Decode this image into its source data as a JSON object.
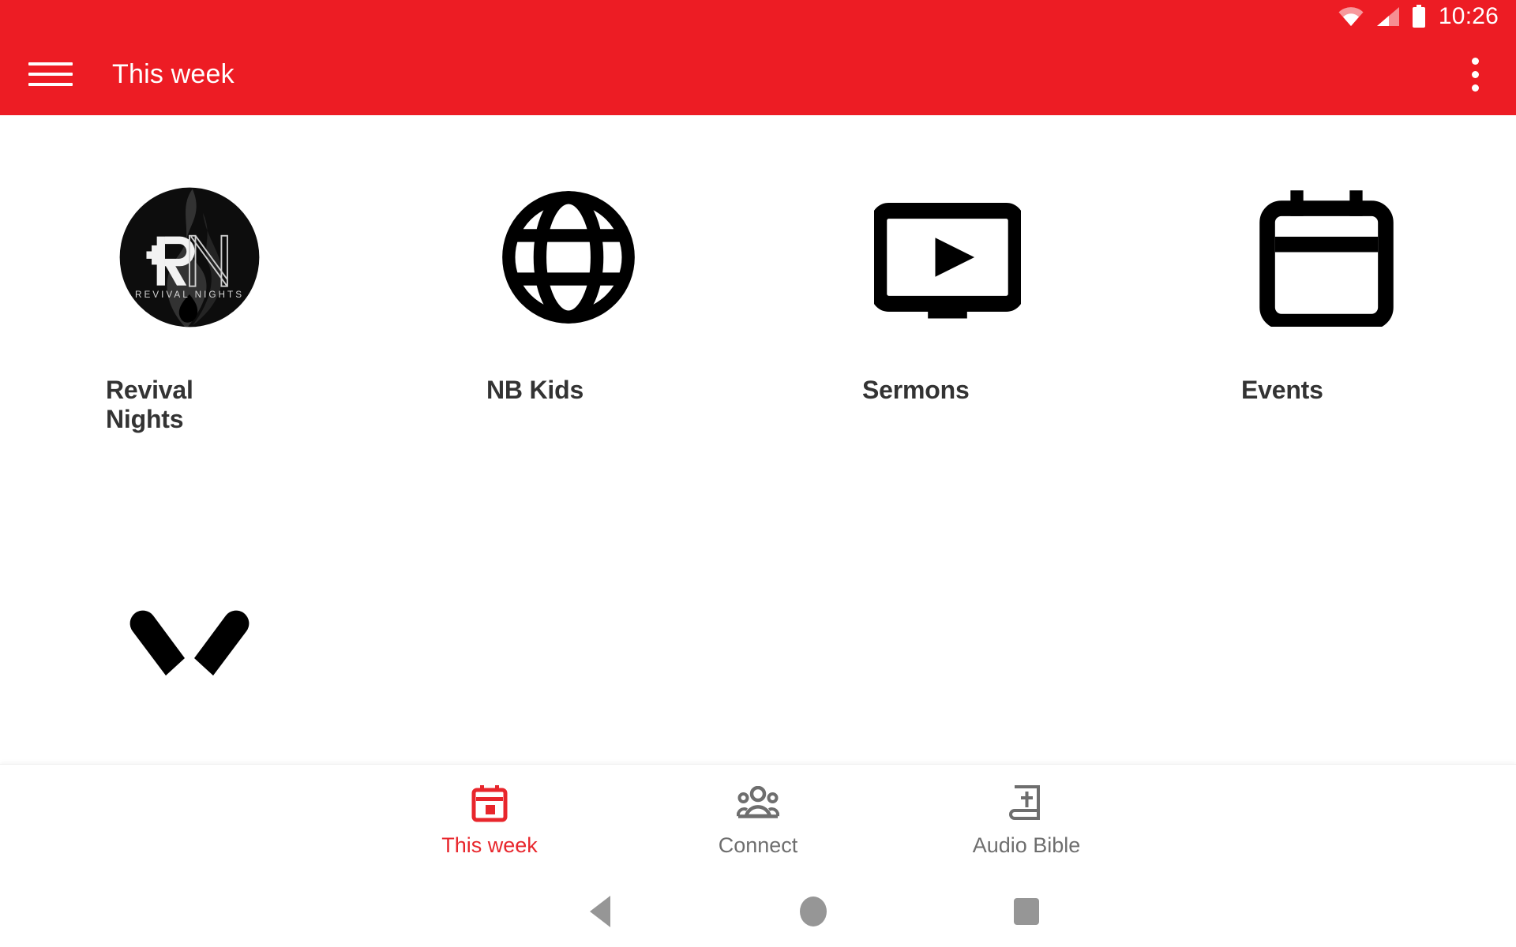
{
  "statusbar": {
    "clock": "10:26",
    "icons": [
      "wifi-icon",
      "cellular-signal-icon",
      "battery-icon"
    ]
  },
  "appbar": {
    "menu_icon": "hamburger-menu-icon",
    "title": "This week",
    "overflow_icon": "overflow-menu-icon",
    "background_color": "#ED1C24",
    "text_color": "#FFFFFF"
  },
  "main": {
    "tiles": [
      {
        "label": "Revival Nights",
        "icon": "revival-nights-logo-icon"
      },
      {
        "label": "NB Kids",
        "icon": "globe-icon"
      },
      {
        "label": "Sermons",
        "icon": "tv-play-icon"
      },
      {
        "label": "Events",
        "icon": "calendar-icon"
      }
    ],
    "second_row_partial": [
      {
        "label": "",
        "icon": "praying-hands-icon"
      }
    ],
    "logo_text": {
      "monogram": "RN",
      "wordmark": "REVIVAL NIGHTS"
    }
  },
  "bottom_nav": {
    "active_color": "#E8262C",
    "inactive_color": "#6E6E6E",
    "items": [
      {
        "label": "This week",
        "icon": "calendar-today-icon",
        "active": true
      },
      {
        "label": "Connect",
        "icon": "people-group-icon",
        "active": false
      },
      {
        "label": "Audio Bible",
        "icon": "bible-book-icon",
        "active": false
      }
    ]
  },
  "system_nav": {
    "buttons": [
      {
        "name": "back-button",
        "icon": "triangle-back-icon"
      },
      {
        "name": "home-button",
        "icon": "circle-home-icon"
      },
      {
        "name": "recents-button",
        "icon": "square-recents-icon"
      }
    ],
    "color": "#969696"
  }
}
